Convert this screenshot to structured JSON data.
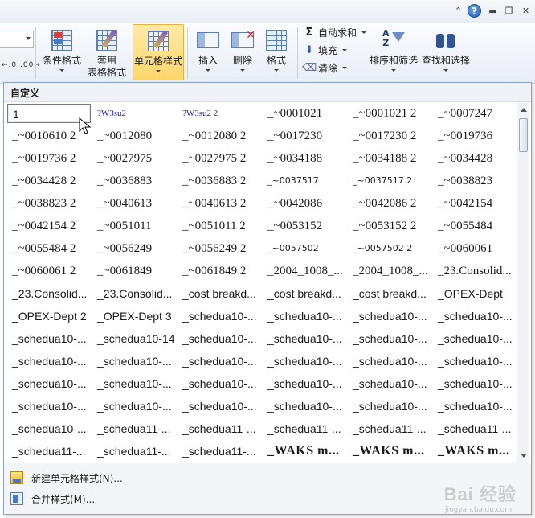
{
  "ribbon": {
    "number_format_glyphs": "←.0 .00→",
    "buttons": {
      "conditional_format": "条件格式",
      "format_as_table_line1": "套用",
      "format_as_table_line2": "表格格式",
      "cell_styles": "单元格样式",
      "insert": "插入",
      "delete": "删除",
      "format": "格式",
      "sort_filter": "排序和筛选",
      "find_select": "查找和选择"
    },
    "editing": {
      "autosum": "自动求和",
      "fill": "填充",
      "clear": "清除"
    }
  },
  "panel": {
    "header": "自定义",
    "cells": [
      [
        "1",
        "?W3su2",
        "?W3su2 2",
        "_~0001021",
        "_~0001021 2",
        "_~0007247"
      ],
      [
        "_~0010610 2",
        "_~0012080",
        "_~0012080 2",
        "_~0017230",
        "_~0017230 2",
        "_~0019736"
      ],
      [
        "_~0019736 2",
        "_~0027975",
        "_~0027975 2",
        "_~0034188",
        "_~0034188 2",
        "_~0034428"
      ],
      [
        "_~0034428 2",
        "_~0036883",
        "_~0036883 2",
        "_~0037517",
        "_~0037517 2",
        "_~0038823"
      ],
      [
        "_~0038823 2",
        "_~0040613",
        "_~0040613 2",
        "_~0042086",
        "_~0042086 2",
        "_~0042154"
      ],
      [
        "_~0042154 2",
        "_~0051011",
        "_~0051011 2",
        "_~0053152",
        "_~0053152 2",
        "_~0055484"
      ],
      [
        "_~0055484 2",
        "_~0056249",
        "_~0056249 2",
        "_~0057502",
        "_~0057502 2",
        "_~0060061"
      ],
      [
        "_~0060061 2",
        "_~0061849",
        "_~0061849 2",
        "_2004_1008_...",
        "_2004_1008_...",
        "_23.Consolid..."
      ],
      [
        "_23.Consolid...",
        "_23.Consolid...",
        "_cost breakd...",
        "_cost breakd...",
        "_cost breakd...",
        "_OPEX-Dept"
      ],
      [
        "_OPEX-Dept 2",
        "_OPEX-Dept 3",
        "_schedua10-...",
        "_schedua10-...",
        "_schedua10-...",
        "_schedua10-..."
      ],
      [
        "_schedua10-...",
        "_schedua10-14",
        "_schedua10-...",
        "_schedua10-...",
        "_schedua10-...",
        "_schedua10-..."
      ],
      [
        "_schedua10-...",
        "_schedua10-...",
        "_schedua10-...",
        "_schedua10-...",
        "_schedua10-...",
        "_schedua10-..."
      ],
      [
        "_schedua10-...",
        "_schedua10-...",
        "_schedua10-...",
        "_schedua10-...",
        "_schedua10-...",
        "_schedua10-..."
      ],
      [
        "_schedua10-...",
        "_schedua10-...",
        "_schedua10-...",
        "_schedua10-...",
        "_schedua10-...",
        "_schedua10-..."
      ],
      [
        "_schedua10-...",
        "_schedua11-...",
        "_schedua11-...",
        "_schedua11-...",
        "_schedua11-...",
        "_schedua11-..."
      ],
      [
        "_schedua11-...",
        "_schedua11-...",
        "_schedua11-...",
        "_WAKS m...",
        "_WAKS m...",
        "_WAKS m..."
      ]
    ],
    "footer": {
      "new_style": "新建单元格样式(N)...",
      "merge_styles": "合并样式(M)..."
    }
  },
  "watermark": {
    "brand": "Bai  经验",
    "sub": "jingyan.baidu.com"
  },
  "colors": {
    "active_button": "#ffd66a",
    "link_text": "#1a1ad0",
    "panel_border": "#8ea3bf"
  }
}
